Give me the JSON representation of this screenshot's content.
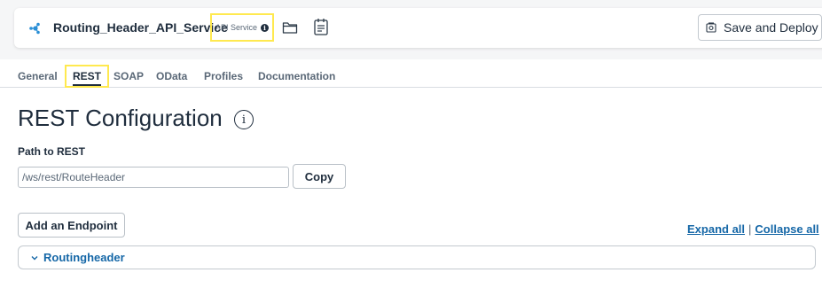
{
  "header": {
    "title": "Routing_Header_API_Service",
    "badge": "API Service",
    "badge_info": "i",
    "deploy_label": "Save and Deploy"
  },
  "tabs": [
    {
      "label": "General"
    },
    {
      "label": "REST",
      "active": true
    },
    {
      "label": "SOAP"
    },
    {
      "label": "OData"
    },
    {
      "label": "Profiles"
    },
    {
      "label": "Documentation"
    }
  ],
  "main": {
    "heading": "REST Configuration",
    "heading_info": "i",
    "path_label": "Path to REST",
    "path_value": "/ws/rest/RouteHeader",
    "copy_label": "Copy",
    "add_endpoint_label": "Add an Endpoint",
    "expand_all": "Expand all",
    "separator": "|",
    "collapse_all": "Collapse all",
    "endpoint": "Routingheader"
  },
  "colors": {
    "accent_link": "#1567a7",
    "highlight": "#ffe94f",
    "text_dark": "#1f2d3d"
  }
}
